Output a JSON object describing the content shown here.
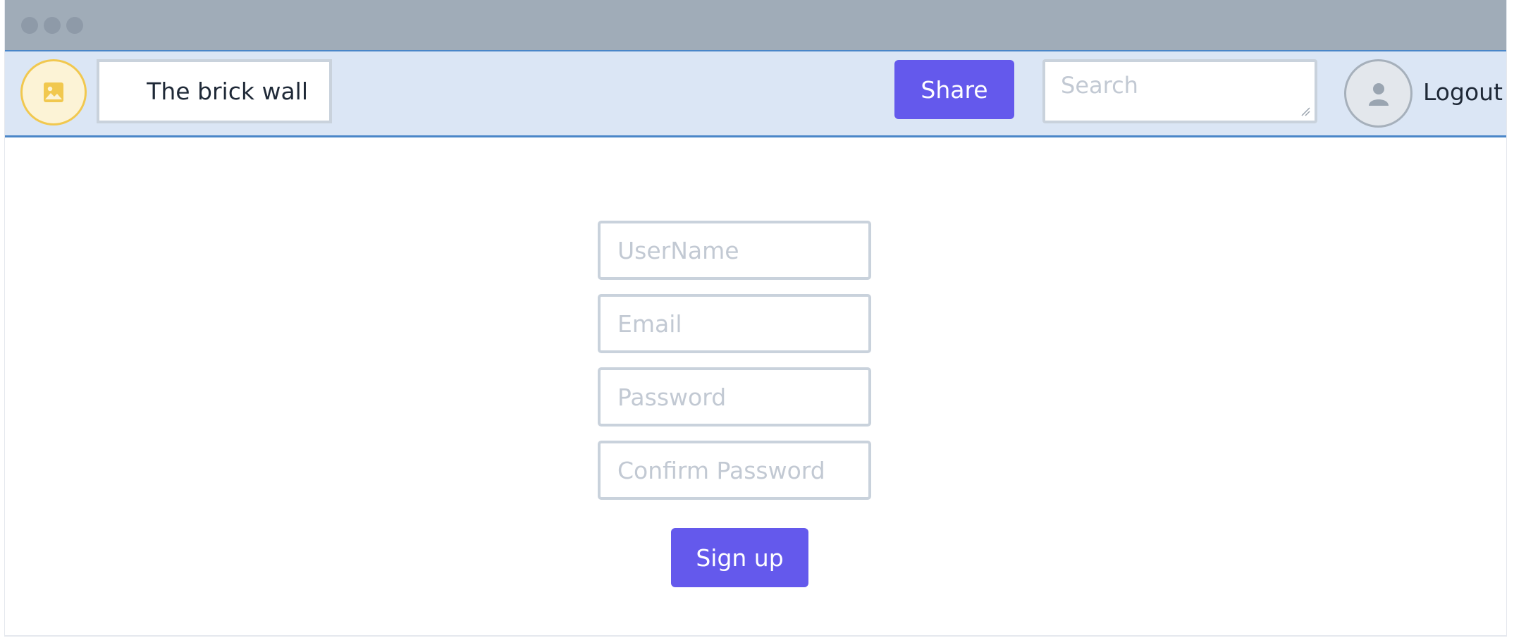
{
  "window": {
    "controls": [
      "close",
      "minimize",
      "maximize"
    ]
  },
  "navbar": {
    "logo_icon": "image-icon",
    "site_title": "The brick wall",
    "share_label": "Share",
    "search_placeholder": "Search",
    "avatar_icon": "user-icon",
    "logout_label": "Logout"
  },
  "signup_form": {
    "username_placeholder": "UserName",
    "email_placeholder": "Email",
    "password_placeholder": "Password",
    "confirm_password_placeholder": "Confirm Password",
    "submit_label": "Sign up"
  },
  "colors": {
    "accent": "#6459ec",
    "navbar_bg": "#dbe6f5",
    "navbar_border": "#4a86c8",
    "titlebar_bg": "#a0acb8",
    "logo_bg": "#fcf3d6",
    "logo_border": "#f1c84f"
  }
}
